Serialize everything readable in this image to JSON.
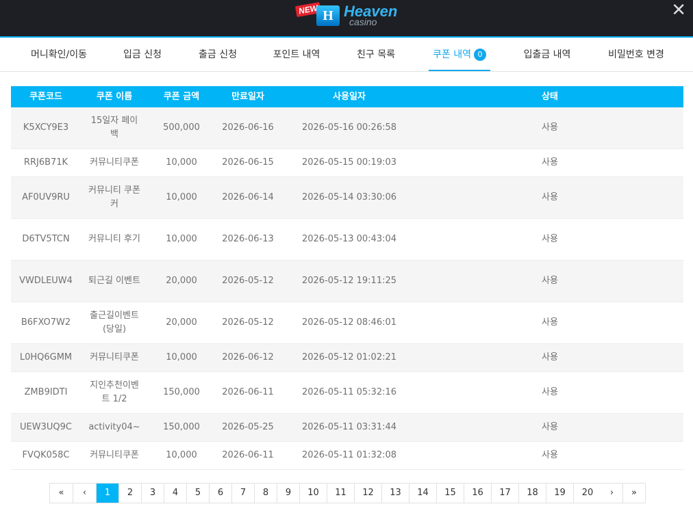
{
  "header": {
    "logo_badge": "NEW",
    "logo_mark": "H",
    "brand": "Heaven",
    "brand_sub": "casino",
    "close": "✕"
  },
  "tabs": [
    {
      "label": "머니확인/이동"
    },
    {
      "label": "입금 신청"
    },
    {
      "label": "출금 신청"
    },
    {
      "label": "포인트 내역"
    },
    {
      "label": "친구 목록"
    },
    {
      "label": "쿠폰 내역",
      "badge": "0",
      "active": true
    },
    {
      "label": "입출금 내역"
    },
    {
      "label": "비밀번호 변경"
    }
  ],
  "table": {
    "headers": [
      "쿠폰코드",
      "쿠폰 이름",
      "쿠폰 금액",
      "만료일자",
      "사용일자",
      "상태"
    ],
    "rows": [
      {
        "code": "K5XCY9E3",
        "name": "15일자 페이백",
        "amount": "500,000",
        "expires": "2026-06-16",
        "used": "2026-05-16 00:26:58",
        "status": "사용"
      },
      {
        "code": "RRJ6B71K",
        "name": "커뮤니티쿠폰",
        "amount": "10,000",
        "expires": "2026-06-15",
        "used": "2026-05-15 00:19:03",
        "status": "사용"
      },
      {
        "code": "AF0UV9RU",
        "name": "커뮤니티 쿠폰커",
        "amount": "10,000",
        "expires": "2026-06-14",
        "used": "2026-05-14 03:30:06",
        "status": "사용"
      },
      {
        "code": "D6TV5TCN",
        "name": "커뮤니티 후기",
        "amount": "10,000",
        "expires": "2026-06-13",
        "used": "2026-05-13 00:43:04",
        "status": "사용"
      },
      {
        "code": "VWDLEUW4",
        "name": "퇴근길 이벤트",
        "amount": "20,000",
        "expires": "2026-05-12",
        "used": "2026-05-12 19:11:25",
        "status": "사용"
      },
      {
        "code": "B6FXO7W2",
        "name": "출근길이벤트(당일)",
        "amount": "20,000",
        "expires": "2026-05-12",
        "used": "2026-05-12 08:46:01",
        "status": "사용"
      },
      {
        "code": "L0HQ6GMM",
        "name": "커뮤니티쿠폰",
        "amount": "10,000",
        "expires": "2026-06-12",
        "used": "2026-05-12 01:02:21",
        "status": "사용"
      },
      {
        "code": "ZMB9IDTI",
        "name": "지인추천이벤트 1/2",
        "amount": "150,000",
        "expires": "2026-06-11",
        "used": "2026-05-11 05:32:16",
        "status": "사용"
      },
      {
        "code": "UEW3UQ9C",
        "name": "activity04~",
        "amount": "150,000",
        "expires": "2026-05-25",
        "used": "2026-05-11 03:31:44",
        "status": "사용"
      },
      {
        "code": "FVQK058C",
        "name": "커뮤니티쿠폰",
        "amount": "10,000",
        "expires": "2026-06-11",
        "used": "2026-05-11 01:32:08",
        "status": "사용"
      }
    ]
  },
  "pagination": {
    "first": "«",
    "prev": "‹",
    "pages": [
      "1",
      "2",
      "3",
      "4",
      "5",
      "6",
      "7",
      "8",
      "9",
      "10",
      "11",
      "12",
      "13",
      "14",
      "15",
      "16",
      "17",
      "18",
      "19",
      "20"
    ],
    "current": "1",
    "next": "›",
    "last": "»"
  },
  "colors": {
    "accent": "#00b4f5",
    "header_bg": "#1e1f24",
    "row_alt": "#f5f5f5"
  }
}
